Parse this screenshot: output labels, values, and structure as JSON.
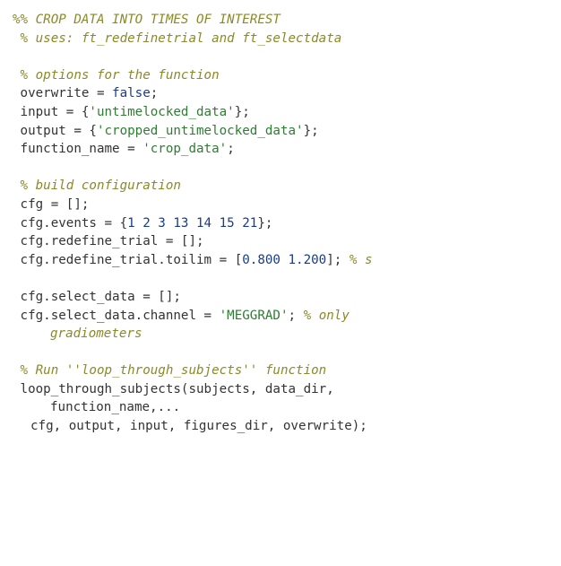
{
  "code": {
    "c1": "%% CROP DATA INTO TIMES OF INTEREST",
    "c2": " % uses: ft_redefinetrial and ft_selectdata",
    "c3": " % options for the function",
    "l4a": " overwrite = ",
    "l4b": "false",
    "l4c": ";",
    "l5a": " input = {",
    "l5b": "'untimelocked_data'",
    "l5c": "};",
    "l6a": " output = {",
    "l6b": "'cropped_untimelocked_data'",
    "l6c": "};",
    "l7a": " function_name = ",
    "l7b": "'crop_data'",
    "l7c": ";",
    "c8": " % build configuration",
    "l9": " cfg = [];",
    "l10a": " cfg.events = {",
    "l10b": "1 2 3 13 14 15 21",
    "l10c": "};",
    "l11": " cfg.redefine_trial = [];",
    "l12a": " cfg.redefine_trial.toilim = [",
    "l12b": "0.800 1.200",
    "l12c": "]; ",
    "l12d": "% s",
    "l13": " cfg.select_data = [];",
    "l14a": " cfg.select_data.channel = ",
    "l14b": "'MEGGRAD'",
    "l14c": "; ",
    "l14d": "% only",
    "l14e": "gradiometers",
    "c15": " % Run ''loop_through_subjects'' function",
    "l16": " loop_through_subjects(subjects, data_dir,",
    "l16b": "function_name,...",
    "l17": "cfg, output, input, figures_dir, overwrite);"
  }
}
